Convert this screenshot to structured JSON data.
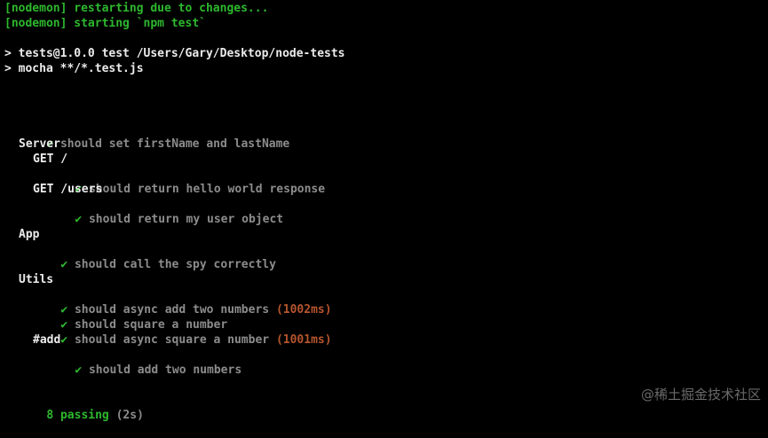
{
  "nodemon": {
    "restarting": "[nodemon] restarting due to changes...",
    "starting": "[nodemon] starting `npm test`"
  },
  "npm": {
    "script_line": "> tests@1.0.0 test /Users/Gary/Desktop/node-tests",
    "command_line": "> mocha **/*.test.js"
  },
  "check_glyph": "✔",
  "results": {
    "root_test": "should set firstName and lastName",
    "server": {
      "title": "Server",
      "get_root": {
        "title": "GET /",
        "test": "should return hello world response"
      },
      "get_users": {
        "title": "GET /users",
        "test": "should return my user object"
      }
    },
    "app": {
      "title": "App",
      "test": "should call the spy correctly"
    },
    "utils": {
      "title": "Utils",
      "tests": [
        {
          "label": "should async add two numbers",
          "duration": "(1002ms)"
        },
        {
          "label": "should square a number",
          "duration": ""
        },
        {
          "label": "should async square a number",
          "duration": "(1001ms)"
        }
      ],
      "add": {
        "title": "#add",
        "test": "should add two numbers"
      }
    }
  },
  "summary": {
    "passing": "8 passing",
    "time": "(2s)"
  },
  "watermark": "@稀土掘金技术社区",
  "colors": {
    "background": "#000000",
    "green": "#2eb82e",
    "white": "#ececec",
    "gray": "#8c8c8c",
    "slow_duration": "#b5552d"
  }
}
